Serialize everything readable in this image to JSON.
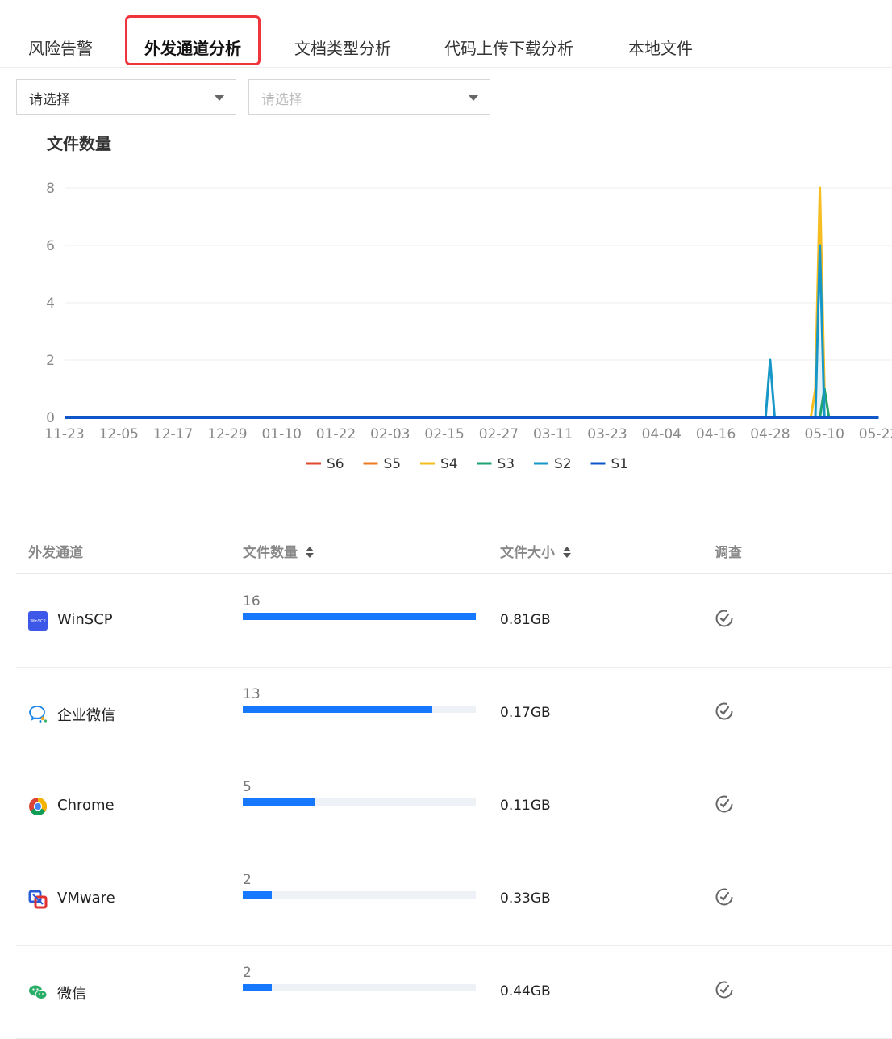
{
  "tabs": [
    {
      "label": "风险告警",
      "active": false
    },
    {
      "label": "外发通道分析",
      "active": true
    },
    {
      "label": "文档类型分析",
      "active": false
    },
    {
      "label": "代码上传下载分析",
      "active": false
    },
    {
      "label": "本地文件",
      "active": false
    }
  ],
  "filters": {
    "select1": {
      "value": "请选择"
    },
    "select2": {
      "placeholder": "请选择"
    }
  },
  "chart_title": "文件数量",
  "chart_data": {
    "type": "line",
    "title": "文件数量",
    "xlabel": "",
    "ylabel": "",
    "ylim": [
      0,
      8
    ],
    "y_ticks": [
      0,
      2,
      4,
      6,
      8
    ],
    "x_ticks": [
      "11-23",
      "12-05",
      "12-17",
      "12-29",
      "01-10",
      "01-22",
      "02-03",
      "02-15",
      "02-27",
      "03-11",
      "03-23",
      "04-04",
      "04-16",
      "04-28",
      "05-10",
      "05-22"
    ],
    "grid": true,
    "legend_position": "bottom",
    "series": [
      {
        "name": "S6",
        "color": "#e0492e",
        "points": [
          {
            "x": "11-23",
            "y": 0
          },
          {
            "x": "05-22",
            "y": 0
          }
        ]
      },
      {
        "name": "S5",
        "color": "#ec7b22",
        "points": [
          {
            "x": "11-23",
            "y": 0
          },
          {
            "x": "05-22",
            "y": 0
          }
        ]
      },
      {
        "name": "S4",
        "color": "#f5bd1f",
        "points": [
          {
            "x": "11-23",
            "y": 0
          },
          {
            "x": "05-07",
            "y": 0
          },
          {
            "x": "05-08",
            "y": 1
          },
          {
            "x": "05-09",
            "y": 8
          },
          {
            "x": "05-10",
            "y": 1
          },
          {
            "x": "05-11",
            "y": 0
          },
          {
            "x": "05-22",
            "y": 0
          }
        ]
      },
      {
        "name": "S3",
        "color": "#1fa372",
        "points": [
          {
            "x": "11-23",
            "y": 0
          },
          {
            "x": "05-09",
            "y": 0
          },
          {
            "x": "05-10",
            "y": 1
          },
          {
            "x": "05-11",
            "y": 0
          },
          {
            "x": "05-22",
            "y": 0
          }
        ]
      },
      {
        "name": "S2",
        "color": "#1797c8",
        "points": [
          {
            "x": "11-23",
            "y": 0
          },
          {
            "x": "04-27",
            "y": 0
          },
          {
            "x": "04-28",
            "y": 2
          },
          {
            "x": "04-29",
            "y": 0
          },
          {
            "x": "05-08",
            "y": 0
          },
          {
            "x": "05-09",
            "y": 6
          },
          {
            "x": "05-10",
            "y": 0
          },
          {
            "x": "05-22",
            "y": 0
          }
        ]
      },
      {
        "name": "S1",
        "color": "#0f57c9",
        "points": [
          {
            "x": "11-23",
            "y": 0
          },
          {
            "x": "05-22",
            "y": 0
          }
        ]
      }
    ]
  },
  "table": {
    "headers": {
      "channel": "外发通道",
      "count": "文件数量",
      "size": "文件大小",
      "action": "调查"
    },
    "rows": [
      {
        "name": "WinSCP",
        "icon": "winscp-icon",
        "icon_text": "WinSCP",
        "count": "16",
        "count_fraction": 1.0,
        "size": "0.81GB"
      },
      {
        "name": "企业微信",
        "icon": "wecom-icon",
        "count": "13",
        "count_fraction": 0.8125,
        "size": "0.17GB"
      },
      {
        "name": "Chrome",
        "icon": "chrome-icon",
        "count": "5",
        "count_fraction": 0.3125,
        "size": "0.11GB"
      },
      {
        "name": "VMware",
        "icon": "vmware-icon",
        "count": "2",
        "count_fraction": 0.125,
        "size": "0.33GB"
      },
      {
        "name": "微信",
        "icon": "wechat-icon",
        "count": "2",
        "count_fraction": 0.125,
        "size": "0.44GB"
      }
    ]
  }
}
